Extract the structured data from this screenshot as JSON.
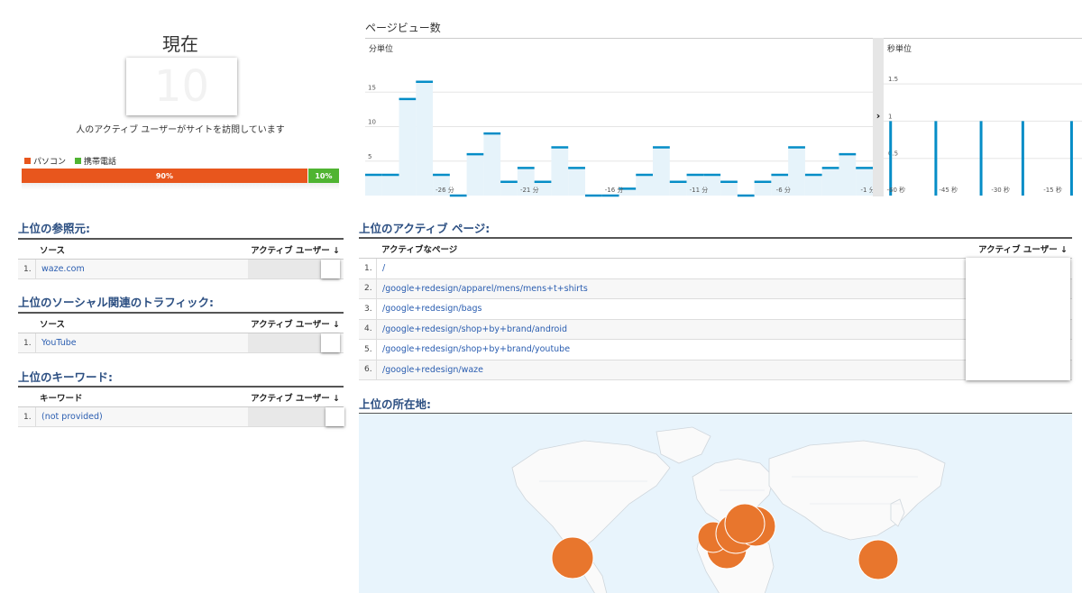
{
  "now": {
    "title": "現在",
    "count": "10",
    "caption": "人のアクティブ ユーザーがサイトを訪問しています"
  },
  "device": {
    "legend": [
      {
        "label": "パソコン",
        "color": "#e8561d"
      },
      {
        "label": "携帯電話",
        "color": "#50b432"
      }
    ],
    "desktop_pct": "90%",
    "mobile_pct": "10%",
    "desktop_share": 90,
    "mobile_share": 10
  },
  "referrals": {
    "title": "上位の参照元:",
    "col_source": "ソース",
    "col_users": "アクティブ ユーザー",
    "sort_icon": "↓",
    "rows": [
      {
        "num": "1.",
        "label": "waze.com"
      }
    ]
  },
  "social": {
    "title": "上位のソーシャル関連のトラフィック:",
    "col_source": "ソース",
    "col_users": "アクティブ ユーザー",
    "sort_icon": "↓",
    "rows": [
      {
        "num": "1.",
        "label": "YouTube"
      }
    ]
  },
  "keywords": {
    "title": "上位のキーワード:",
    "col_source": "キーワード",
    "col_users": "アクティブ ユーザー",
    "sort_icon": "↓",
    "rows": [
      {
        "num": "1.",
        "label": "(not provided)"
      }
    ]
  },
  "pageviews": {
    "title": "ページビュー数",
    "minute_label": "分単位",
    "second_label": "秒単位",
    "expand_icon": "chevron-right-icon"
  },
  "chart_data": [
    {
      "type": "bar",
      "title": "分単位",
      "x_ticks": [
        "-26 分",
        "-21 分",
        "-16 分",
        "-11 分",
        "-6 分",
        "-1 分"
      ],
      "y_ticks": [
        "5",
        "10",
        "15"
      ],
      "ylim": [
        0,
        20
      ],
      "values": [
        3,
        3,
        14,
        16.5,
        3,
        0,
        6,
        9,
        2,
        4,
        2,
        7,
        4,
        0,
        0,
        1,
        3,
        7,
        2,
        3,
        3,
        2,
        0,
        2,
        3,
        7,
        3,
        4,
        6,
        4
      ],
      "color": "#058dc7",
      "fill": "#e6f3fa"
    },
    {
      "type": "bar",
      "title": "秒単位",
      "x_ticks": [
        "-60 秒",
        "-45 秒",
        "-30 秒",
        "-15 秒"
      ],
      "y_ticks": [
        "0.5",
        "1",
        "1.5"
      ],
      "ylim": [
        0,
        2
      ],
      "bars_at": [
        -59,
        -46,
        -33,
        -21,
        -7
      ],
      "values": [
        1,
        1,
        1,
        1,
        1
      ],
      "color": "#058dc7"
    }
  ],
  "active_pages": {
    "title": "上位のアクティブ ページ:",
    "col_page": "アクティブなページ",
    "col_users": "アクティブ ユーザー",
    "sort_icon": "↓",
    "rows": [
      {
        "num": "1.",
        "label": "/"
      },
      {
        "num": "2.",
        "label": "/google+redesign/apparel/mens/mens+t+shirts"
      },
      {
        "num": "3.",
        "label": "/google+redesign/bags"
      },
      {
        "num": "4.",
        "label": "/google+redesign/shop+by+brand/android"
      },
      {
        "num": "5.",
        "label": "/google+redesign/shop+by+brand/youtube"
      },
      {
        "num": "6.",
        "label": "/google+redesign/waze"
      }
    ]
  },
  "locations": {
    "title": "上位の所在地:",
    "bubble_color": "#e8762d"
  }
}
